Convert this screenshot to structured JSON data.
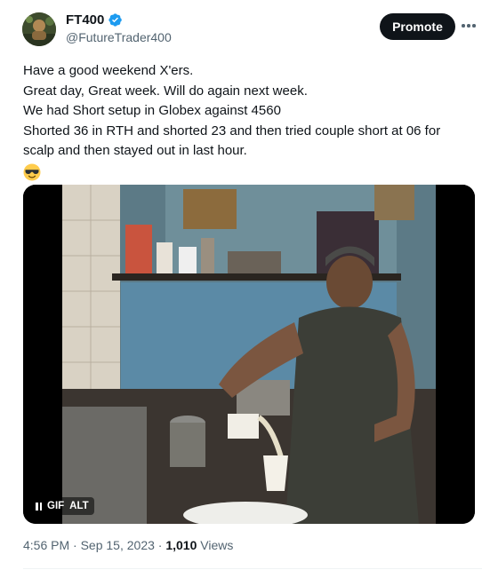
{
  "author": {
    "display_name": "FT400",
    "handle": "@FutureTrader400",
    "verified": true
  },
  "actions": {
    "promote_label": "Promote",
    "more_icon": "more-horizontal-icon"
  },
  "tweet": {
    "lines": [
      "Have a good weekend X'ers.",
      "Great day, Great week. Will do again next week.",
      "We had Short setup in Globex against 4560",
      "Shorted 36 in RTH and shorted 23 and then tried couple short at 06 for",
      "scalp and then stayed out in last hour."
    ],
    "emoji": "smiling-face-with-sunglasses"
  },
  "media": {
    "type": "gif",
    "gif_label": "GIF",
    "alt_label": "ALT",
    "pause_icon": "pause-icon"
  },
  "meta": {
    "time": "4:56 PM",
    "date": "Sep 15, 2023",
    "separator": "·",
    "views_count": "1,010",
    "views_label": "Views"
  },
  "colors": {
    "text_primary": "#0f1419",
    "text_secondary": "#536471",
    "verified_blue": "#1d9bf0",
    "promote_bg": "#0f1419"
  }
}
